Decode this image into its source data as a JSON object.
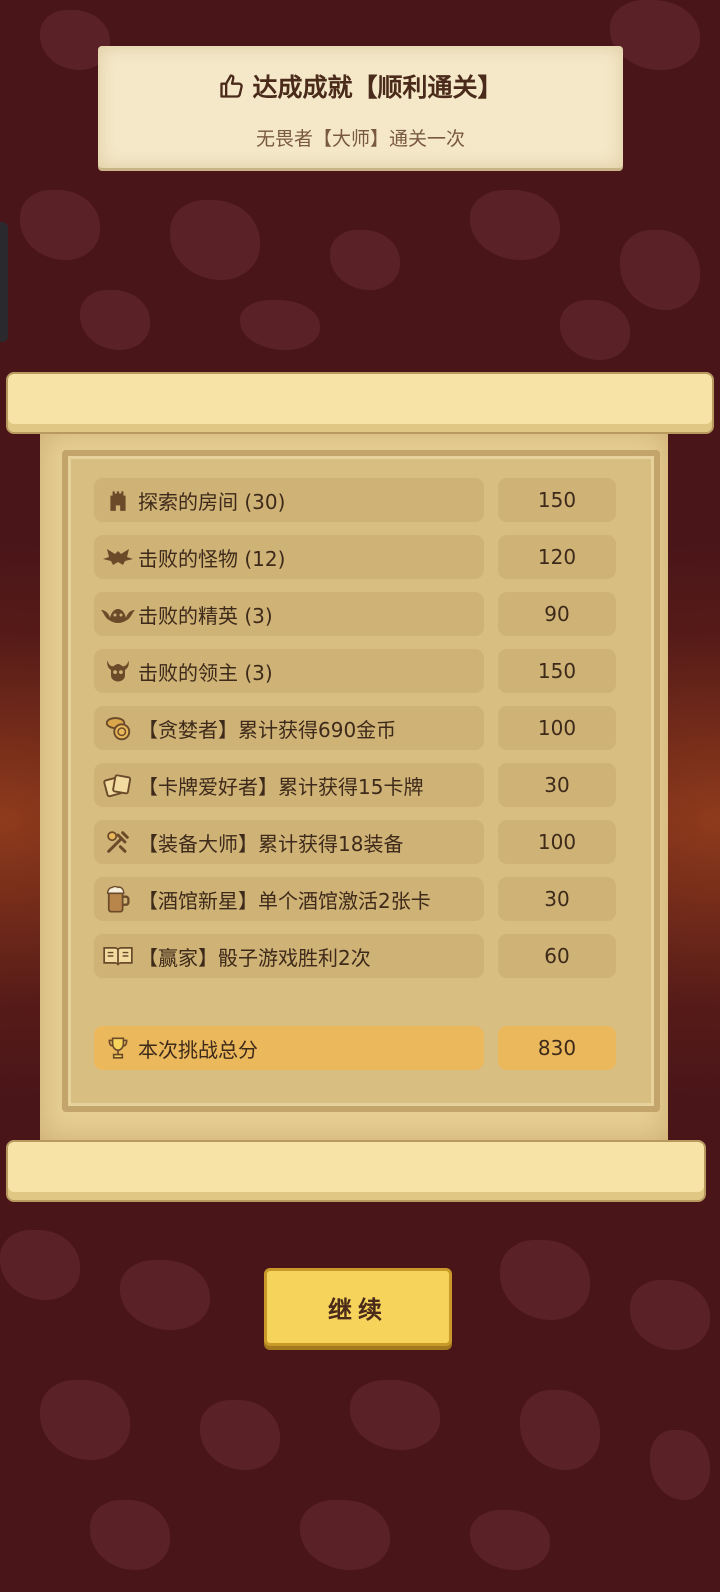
{
  "colors": {
    "background": "#4a1519",
    "paper": "#e7cf94",
    "row": "#cfb276",
    "total_row": "#ebb85c",
    "button": "#f6d35a",
    "text": "#3e2a1a"
  },
  "banner": {
    "icon": "thumbs-up-icon",
    "title": "达成成就【顺利通关】",
    "subtitle": "无畏者【大师】通关一次"
  },
  "score_rows": [
    {
      "icon": "tower-icon",
      "label": "探索的房间 (30)",
      "points": "150"
    },
    {
      "icon": "bat-icon",
      "label": "击败的怪物 (12)",
      "points": "120"
    },
    {
      "icon": "winged-demon-icon",
      "label": "击败的精英 (3)",
      "points": "90"
    },
    {
      "icon": "horned-skull-icon",
      "label": "击败的领主 (3)",
      "points": "150"
    },
    {
      "icon": "coins-icon",
      "label": "【贪婪者】累计获得690金币",
      "points": "100"
    },
    {
      "icon": "cards-icon",
      "label": "【卡牌爱好者】累计获得15卡牌",
      "points": "30"
    },
    {
      "icon": "equipment-icon",
      "label": "【装备大师】累计获得18装备",
      "points": "100"
    },
    {
      "icon": "beer-mug-icon",
      "label": "【酒馆新星】单个酒馆激活2张卡",
      "points": "30"
    },
    {
      "icon": "open-book-icon",
      "label": "【赢家】骰子游戏胜利2次",
      "points": "60"
    }
  ],
  "total": {
    "icon": "trophy-icon",
    "label": "本次挑战总分",
    "points": "830"
  },
  "continue_button": {
    "label": "继续"
  }
}
